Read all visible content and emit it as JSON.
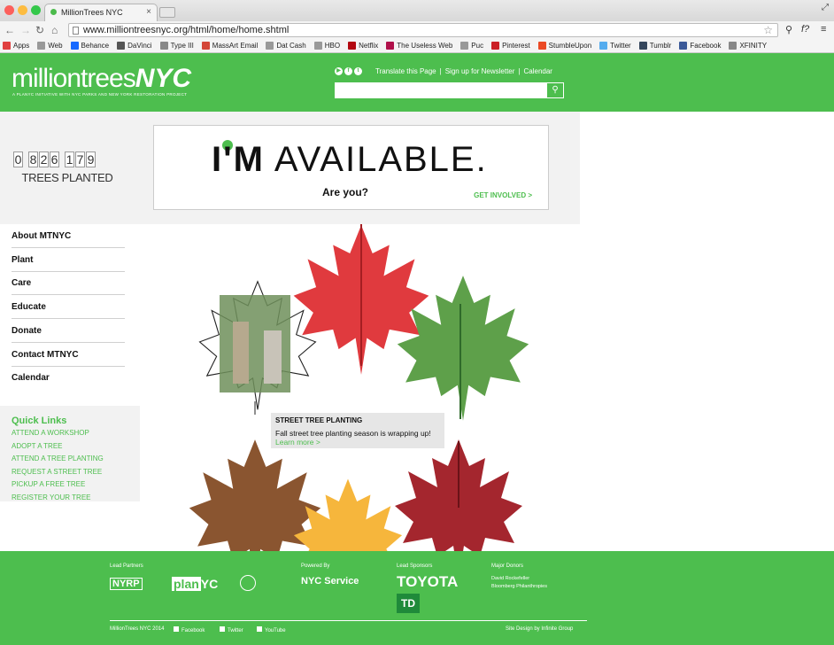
{
  "browser": {
    "tab_title": "MillionTrees NYC",
    "url": "www.milliontreesnyc.org/html/home/home.shtml",
    "bookmarks": [
      {
        "label": "Apps",
        "color": "#e04040"
      },
      {
        "label": "Web",
        "color": "#999999"
      },
      {
        "label": "Behance",
        "color": "#1769ff"
      },
      {
        "label": "DaVinci",
        "color": "#555555"
      },
      {
        "label": "Type III",
        "color": "#888888"
      },
      {
        "label": "MassArt Email",
        "color": "#d44638"
      },
      {
        "label": "Dat Cash",
        "color": "#999999"
      },
      {
        "label": "HBO",
        "color": "#999999"
      },
      {
        "label": "Netflix",
        "color": "#b20710"
      },
      {
        "label": "The Useless Web",
        "color": "#b0104a"
      },
      {
        "label": "Puc",
        "color": "#999999"
      },
      {
        "label": "Pinterest",
        "color": "#cb2027"
      },
      {
        "label": "StumbleUpon",
        "color": "#eb4924"
      },
      {
        "label": "Twitter",
        "color": "#55acee"
      },
      {
        "label": "Tumblr",
        "color": "#35465c"
      },
      {
        "label": "Facebook",
        "color": "#3b5998"
      },
      {
        "label": "XFINITY",
        "color": "#888888"
      }
    ]
  },
  "header": {
    "logo_light": "milliontrees",
    "logo_bold": "NYC",
    "tagline": "A PLANYC INITIATIVE WITH NYC PARKS AND NEW YORK RESTORATION PROJECT",
    "links": [
      "Translate this Page",
      "|",
      "Sign up for Newsletter",
      "|",
      "Calendar"
    ],
    "search_placeholder": ""
  },
  "counter": {
    "digits": [
      "0",
      "8",
      "2",
      "6",
      "1",
      "7",
      "9"
    ],
    "label": "TREES PLANTED"
  },
  "banner": {
    "title_bold": "I'M",
    "title_rest": "AVAILABLE.",
    "subtitle": "Are you?",
    "cta": "GET INVOLVED >"
  },
  "nav": {
    "items": [
      "About MTNYC",
      "Plant",
      "Care",
      "Educate",
      "Donate",
      "Contact MTNYC",
      "Calendar"
    ]
  },
  "quick_links": {
    "heading": "Quick Links",
    "items": [
      "ATTEND A WORKSHOP",
      "ADOPT A TREE",
      "ATTEND A TREE PLANTING",
      "REQUEST A STREET TREE",
      "PICKUP A FREE TREE",
      "REGISTER YOUR TREE"
    ]
  },
  "feature": {
    "title": "STREET TREE PLANTING",
    "body": "Fall street tree planting season is wrapping up!",
    "link": "Learn more >"
  },
  "footer": {
    "lead_partners": "Lead Partners",
    "partner1": "NYRP",
    "partner2_a": "plan",
    "partner2_b": "YC",
    "powered_by": "Powered By",
    "nyc_service": "NYC Service",
    "lead_sponsors": "Lead Sponsors",
    "sponsor": "TOYOTA",
    "sponsor2": "TD",
    "major_donors": "Major Donors",
    "donor1": "David Rockefeller",
    "donor2": "Bloomberg Philanthropies",
    "copyright": "MillionTrees NYC 2014",
    "social": [
      "Facebook",
      "Twitter",
      "YouTube"
    ],
    "credit": "Site Design by Infinite Group"
  },
  "colors": {
    "brand_green": "#4dbe4e"
  }
}
